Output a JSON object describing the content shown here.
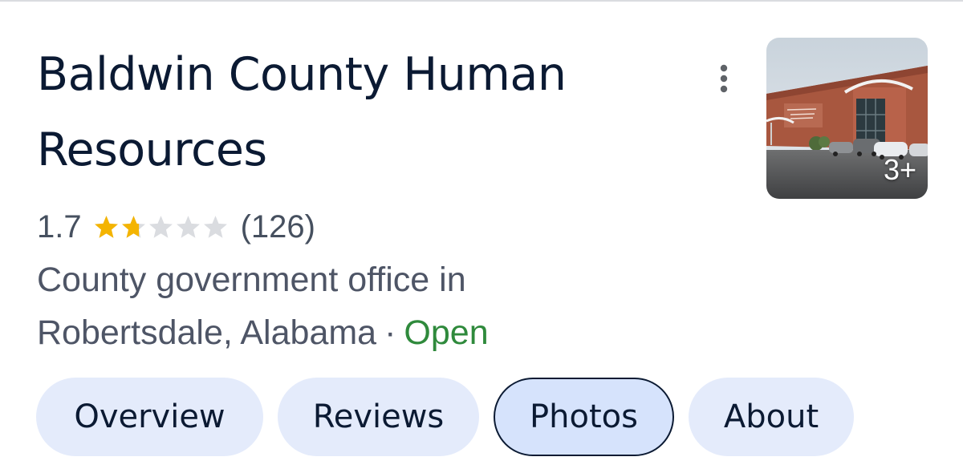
{
  "place": {
    "title": "Baldwin County Human Resources",
    "rating": "1.7",
    "rating_fraction": 0.34,
    "stars_total": 5,
    "review_count": "(126)",
    "category_line": "County government office in",
    "location_line": "Robertsdale, Alabama",
    "separator": "·",
    "status": "Open",
    "photo_count": "3+"
  },
  "tabs": [
    {
      "label": "Overview",
      "active": false
    },
    {
      "label": "Reviews",
      "active": false
    },
    {
      "label": "Photos",
      "active": true
    },
    {
      "label": "About",
      "active": false
    }
  ],
  "icons": {
    "more": "more-vert-icon",
    "star": "star-icon"
  },
  "colors": {
    "star_filled": "#f4b400",
    "star_empty": "#dadce0",
    "open": "#2f8a3c",
    "tab_bg": "#e4ebfb",
    "tab_active_bg": "#d6e3fc",
    "title": "#0b1a33"
  }
}
